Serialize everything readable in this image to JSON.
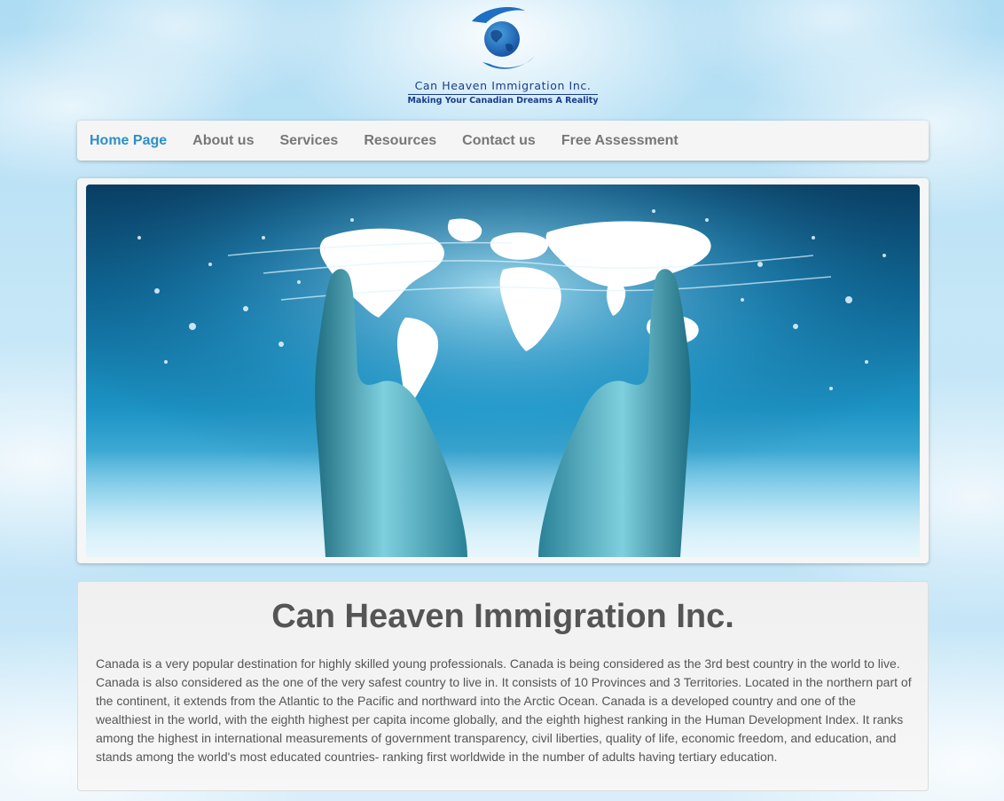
{
  "logo": {
    "name": "Can Heaven Immigration Inc.",
    "tagline": "Making Your Canadian Dreams A Reality"
  },
  "nav": {
    "items": [
      {
        "label": "Home Page",
        "active": true
      },
      {
        "label": "About us",
        "active": false
      },
      {
        "label": "Services",
        "active": false
      },
      {
        "label": "Resources",
        "active": false
      },
      {
        "label": "Contact us",
        "active": false
      },
      {
        "label": "Free Assessment",
        "active": false
      }
    ]
  },
  "content": {
    "title": "Can Heaven Immigration Inc.",
    "body": "Canada is a very popular destination for highly skilled young professionals. Canada is being considered as the 3rd best country in the world to live. Canada is also considered as the one of the very safest country to live in. It consists of 10 Provinces and 3 Territories. Located in the northern part of the continent, it extends from the Atlantic to the Pacific and northward into the Arctic Ocean. Canada is a developed country and one of the wealthiest in the world, with the eighth highest per capita income globally, and the eighth highest ranking in the Human Development Index. It ranks among the highest in international measurements of government transparency, civil liberties, quality of life, economic freedom, and education, and stands among the world's most educated countries- ranking first worldwide in the number of adults having tertiary education."
  },
  "colors": {
    "nav_active": "#2c8fc6",
    "nav_inactive": "#777777",
    "text": "#555555",
    "brand": "#1a3c8c"
  }
}
